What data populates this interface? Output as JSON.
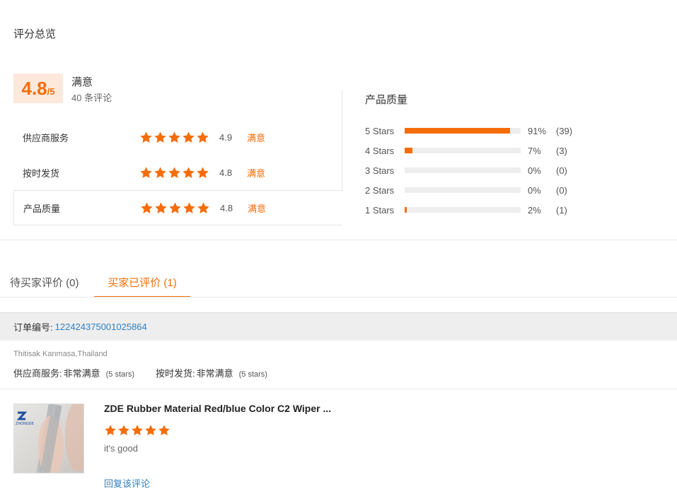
{
  "overview": {
    "title": "评分总览",
    "score": "4.8",
    "score_max": "/5",
    "score_label": "满意",
    "review_count": "40 条评论"
  },
  "ratings": [
    {
      "name": "供应商服务",
      "stars": 5,
      "score": "4.9",
      "text": "满意"
    },
    {
      "name": "按时发货",
      "stars": 5,
      "score": "4.8",
      "text": "满意"
    },
    {
      "name": "产品质量",
      "stars": 5,
      "score": "4.8",
      "text": "满意"
    }
  ],
  "quality": {
    "title": "产品质量",
    "rows": [
      {
        "label": "5  Stars",
        "percent": 91,
        "pct_text": "91%",
        "count": "(39)"
      },
      {
        "label": "4  Stars",
        "percent": 7,
        "pct_text": "7%",
        "count": "(3)"
      },
      {
        "label": "3  Stars",
        "percent": 0,
        "pct_text": "0%",
        "count": "(0)"
      },
      {
        "label": "2  Stars",
        "percent": 0,
        "pct_text": "0%",
        "count": "(0)"
      },
      {
        "label": "1  Stars",
        "percent": 2,
        "pct_text": "2%",
        "count": "(1)"
      }
    ]
  },
  "tabs": {
    "pending": "待买家评价 (0)",
    "done": "买家已评价 (1)"
  },
  "order": {
    "label": "订单编号:",
    "number": "122424375001025864"
  },
  "review": {
    "buyer": "Thitisak Kanmasa,Thailand",
    "supplier_label": "供应商服务:",
    "supplier_value": "非常满意",
    "supplier_stars": "(5 stars)",
    "shipping_label": "按时发货:",
    "shipping_value": "非常满意",
    "shipping_stars": "(5 stars)",
    "product_title": "ZDE Rubber Material Red/blue Color C2 Wiper ...",
    "stars": 5,
    "text": "it's good",
    "reply": "回复该评论",
    "thumb_logo": "ZHONGDE"
  },
  "colors": {
    "accent": "#f56d0a",
    "link": "#2f7fc1"
  }
}
